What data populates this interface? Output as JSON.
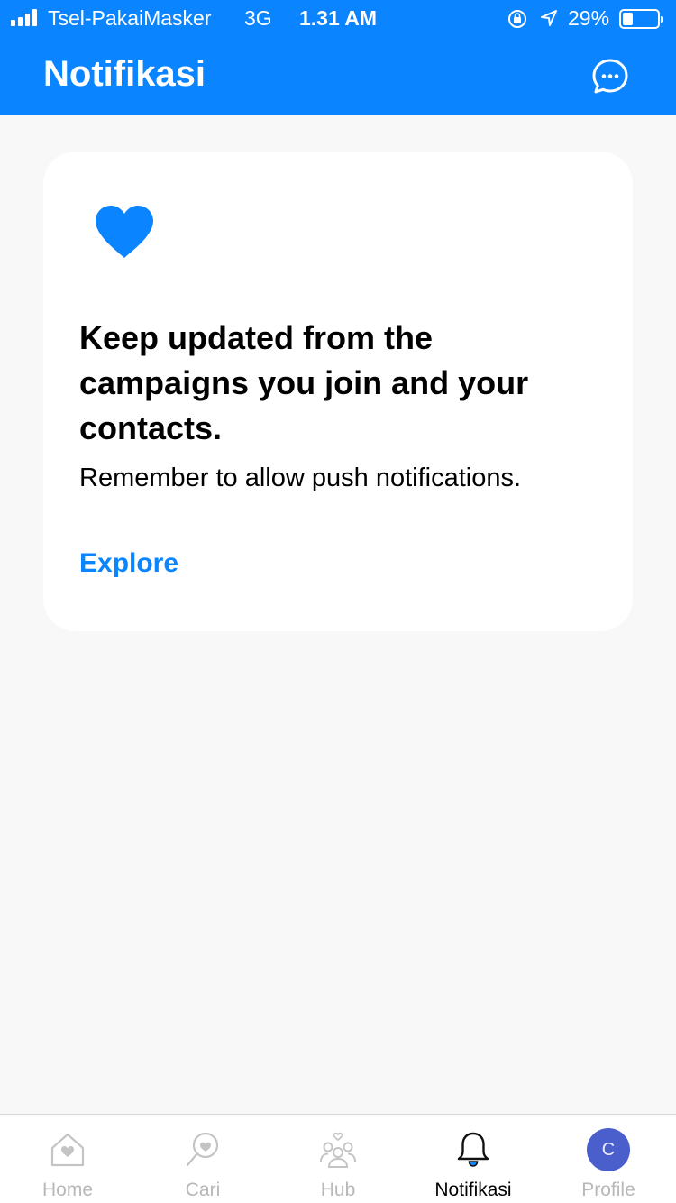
{
  "status_bar": {
    "carrier": "Tsel-PakaiMasker",
    "network": "3G",
    "time": "1.31 AM",
    "battery": "29%",
    "battery_level": 0.29
  },
  "header": {
    "title": "Notifikasi",
    "chat_icon": "chat-bubble-icon"
  },
  "card": {
    "icon": "heart-icon",
    "title": "Keep updated from the campaigns you join and your contacts.",
    "subtitle": "Remember to allow push notifications.",
    "link_label": "Explore"
  },
  "tabs": [
    {
      "label": "Home",
      "icon": "home-icon",
      "active": false
    },
    {
      "label": "Cari",
      "icon": "search-heart-icon",
      "active": false
    },
    {
      "label": "Hub",
      "icon": "people-icon",
      "active": false
    },
    {
      "label": "Notifikasi",
      "icon": "bell-icon",
      "active": true
    },
    {
      "label": "Profile",
      "icon": "avatar",
      "avatar_initial": "C",
      "active": false
    }
  ],
  "colors": {
    "accent": "#0a84ff",
    "background": "#f8f8f8",
    "inactive_tab": "#b8b8b8",
    "avatar": "#4a5fcc"
  }
}
